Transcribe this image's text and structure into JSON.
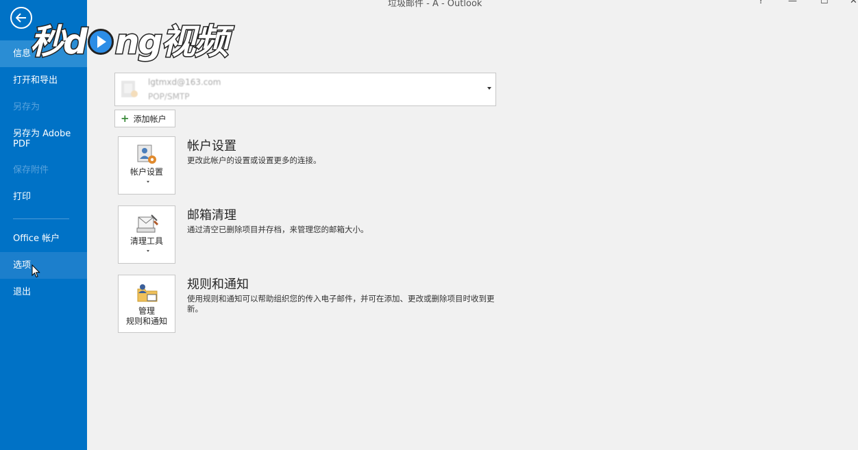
{
  "window": {
    "title": "垃圾邮件 - A - Outlook",
    "controls": [
      "?",
      "—",
      "☐",
      "✕"
    ]
  },
  "watermark": {
    "text_before": "秒d",
    "text_after": "ng视频"
  },
  "sidebar": {
    "items": [
      {
        "label": "信息",
        "state": "active"
      },
      {
        "label": "打开和导出",
        "state": "normal"
      },
      {
        "label": "另存为",
        "state": "disabled"
      },
      {
        "label": "另存为 Adobe\nPDF",
        "line1": "另存为 Adobe",
        "line2": "PDF",
        "state": "normal"
      },
      {
        "label": "保存附件",
        "state": "disabled"
      },
      {
        "label": "打印",
        "state": "normal"
      },
      {
        "label": "Office 帐户",
        "state": "normal"
      },
      {
        "label": "选项",
        "state": "hover"
      },
      {
        "label": "退出",
        "state": "normal"
      }
    ]
  },
  "account": {
    "email": "lgtmxd@163.com",
    "type": "POP/SMTP",
    "add_label": "添加帐户"
  },
  "sections": [
    {
      "tile_label": "帐户设置",
      "title": "帐户设置",
      "description": "更改此帐户的设置或设置更多的连接。"
    },
    {
      "tile_label": "清理工具",
      "title": "邮箱清理",
      "description": "通过清空已删除项目并存档，来管理您的邮箱大小。"
    },
    {
      "tile_line1": "管理",
      "tile_line2": "规则和通知",
      "title": "规则和通知",
      "description": "使用规则和通知可以帮助组织您的传入电子邮件，并可在添加、更改或删除项目时收到更新。"
    }
  ],
  "colors": {
    "sidebar": "#0072c6",
    "sidebar_active": "#2a8dd4",
    "background": "#f1f1f1"
  }
}
